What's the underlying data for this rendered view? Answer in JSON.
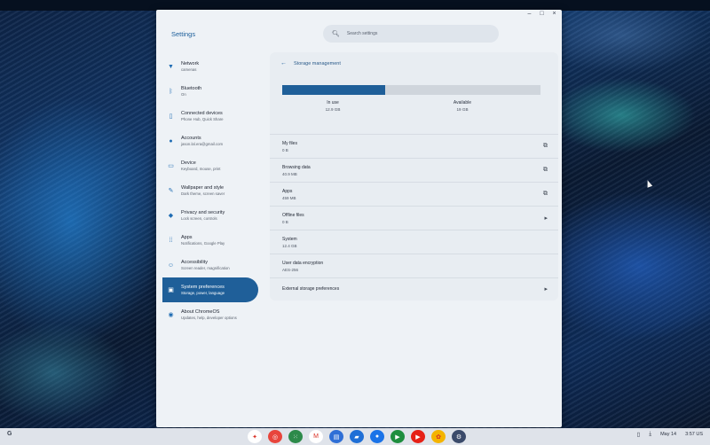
{
  "window": {
    "controls": [
      "–",
      "□",
      "×"
    ]
  },
  "app": {
    "title": "Settings",
    "search_placeholder": "Search settings"
  },
  "sidebar": {
    "items": [
      {
        "label": "Network",
        "sub": "camenas",
        "icon": "wifi-icon"
      },
      {
        "label": "Bluetooth",
        "sub": "On",
        "icon": "bluetooth-icon"
      },
      {
        "label": "Connected devices",
        "sub": "Phone Hub, Quick Share",
        "icon": "phone-icon"
      },
      {
        "label": "Accounts",
        "sub": "jason.lal.era@gmail.com",
        "icon": "account-icon"
      },
      {
        "label": "Device",
        "sub": "Keyboard, mouse, print",
        "icon": "laptop-icon"
      },
      {
        "label": "Wallpaper and style",
        "sub": "Dark theme, screen saver",
        "icon": "palette-icon"
      },
      {
        "label": "Privacy and security",
        "sub": "Lock screen, controls",
        "icon": "shield-icon"
      },
      {
        "label": "Apps",
        "sub": "Notifications, Google Play",
        "icon": "apps-grid-icon"
      },
      {
        "label": "Accessibility",
        "sub": "Screen reader, magnification",
        "icon": "accessibility-icon"
      },
      {
        "label": "System preferences",
        "sub": "Storage, power, language",
        "icon": "system-icon",
        "active": true
      },
      {
        "label": "About ChromeOS",
        "sub": "Updates, help, developer options",
        "icon": "chromeos-icon"
      }
    ]
  },
  "main": {
    "title": "Storage management",
    "storage": {
      "used_fraction": 0.4,
      "in_use_label": "In use",
      "in_use_value": "12.9 GB",
      "available_label": "Available",
      "available_value": "19 GB"
    },
    "rows": [
      {
        "label": "My files",
        "value": "0 B",
        "icon": "external-link-icon"
      },
      {
        "label": "Browsing data",
        "value": "40.9 MB",
        "icon": "external-link-icon"
      },
      {
        "label": "Apps",
        "value": "459 MB",
        "icon": "external-link-icon"
      },
      {
        "label": "Offline files",
        "value": "0 B",
        "icon": "chevron-right-icon"
      },
      {
        "label": "System",
        "value": "12.4 GB",
        "icon": ""
      },
      {
        "label": "User data encryption",
        "value": "AES-256",
        "icon": ""
      },
      {
        "label": "External storage preferences",
        "value": "",
        "icon": "chevron-right-icon"
      }
    ]
  },
  "shelf": {
    "date": "May 14",
    "status": "3:57 US",
    "apps": [
      {
        "name": "assistant",
        "color": "#ffffff"
      },
      {
        "name": "chrome",
        "color": "#e8453c"
      },
      {
        "name": "google-apps",
        "color": "#2d8a4a"
      },
      {
        "name": "gmail",
        "color": "#ffffff"
      },
      {
        "name": "docs",
        "color": "#2f6fd6"
      },
      {
        "name": "files",
        "color": "#1f6fd6"
      },
      {
        "name": "messages",
        "color": "#1a73e8"
      },
      {
        "name": "meet",
        "color": "#1e8e3e"
      },
      {
        "name": "youtube",
        "color": "#e62117"
      },
      {
        "name": "photos",
        "color": "#f4b400"
      },
      {
        "name": "settings",
        "color": "#3b4b6b"
      }
    ]
  }
}
